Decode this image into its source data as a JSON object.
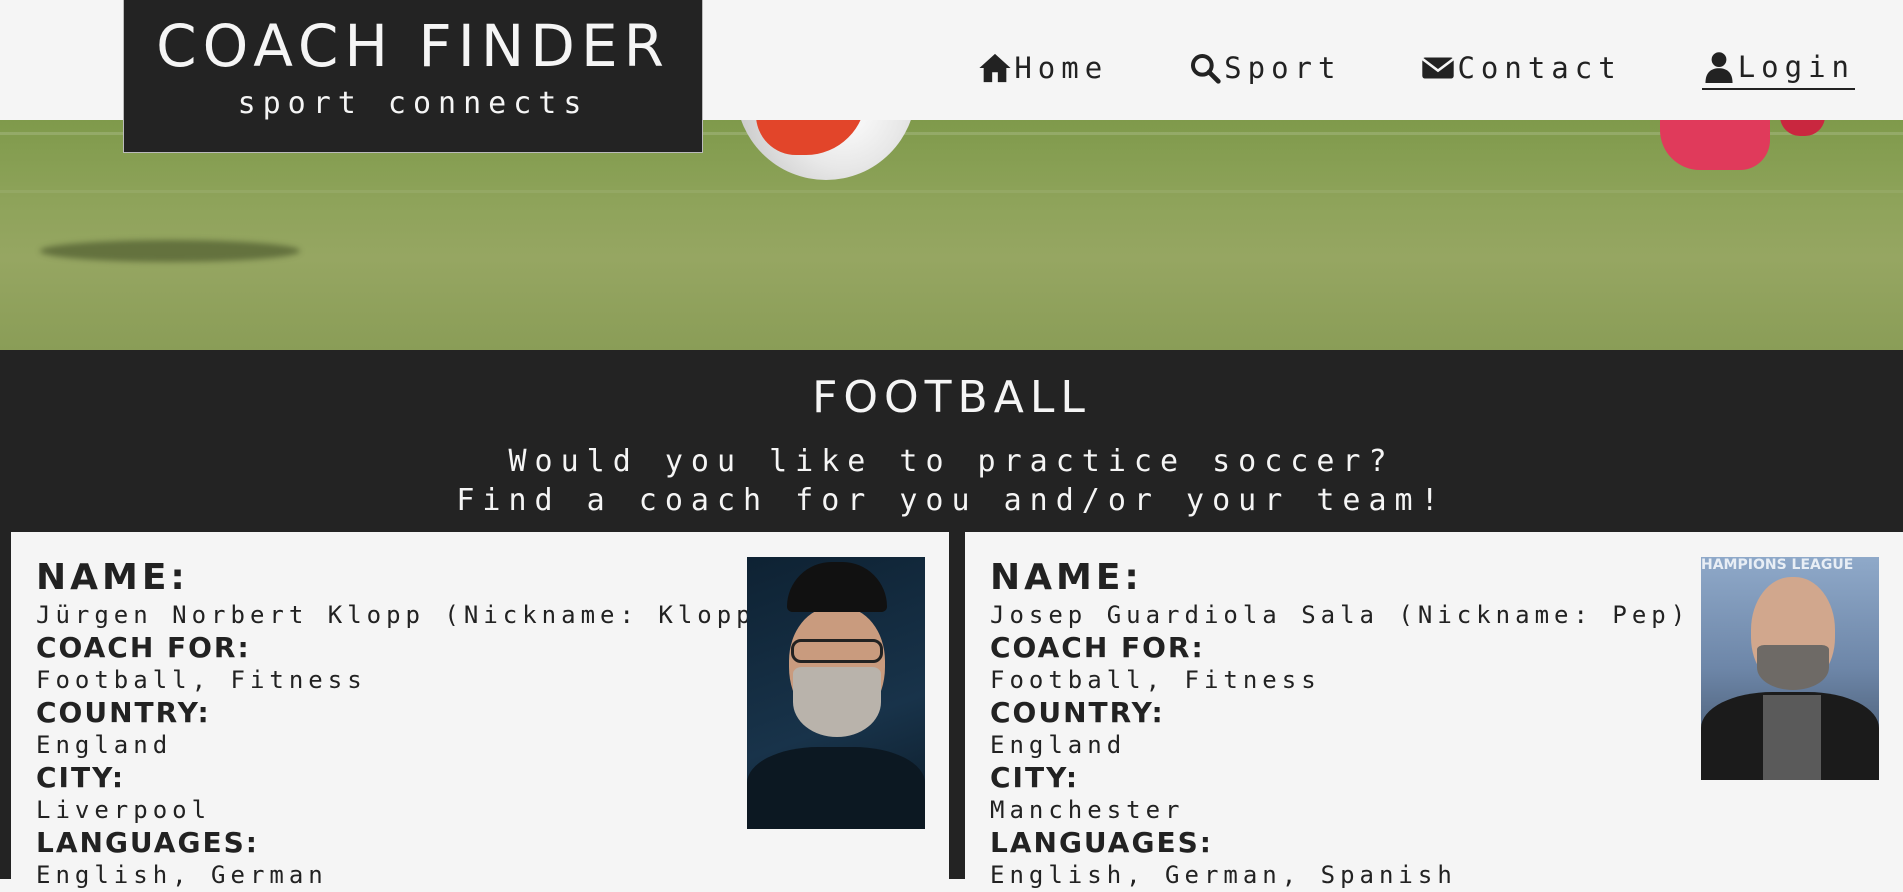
{
  "brand": {
    "title": "COACH FINDER",
    "subtitle": "sport connects"
  },
  "nav": [
    {
      "label": "Home",
      "icon": "home-icon"
    },
    {
      "label": "Sport",
      "icon": "search-icon"
    },
    {
      "label": "Contact",
      "icon": "envelope-icon"
    },
    {
      "label": "Login",
      "icon": "user-icon",
      "active": true
    }
  ],
  "section": {
    "title": "FOOTBALL",
    "subtitle_line1": "Would you like to practice soccer?",
    "subtitle_line2": "Find a coach for you and/or your team!"
  },
  "labels": {
    "name": "NAME:",
    "coach_for": "COACH FOR:",
    "country": "COUNTRY:",
    "city": "CITY:",
    "languages": "LANGUAGES:"
  },
  "coaches": [
    {
      "name": "Jürgen Norbert Klopp (Nickname: Kloppo)",
      "coach_for": "Football, Fitness",
      "country": "England",
      "city": "Liverpool",
      "languages": "English, German"
    },
    {
      "name": "Josep Guardiola Sala (Nickname: Pep)",
      "coach_for": "Football, Fitness",
      "country": "England",
      "city": "Manchester",
      "languages": "English, German, Spanish",
      "photo_text": "HAMPIONS LEAGUE"
    }
  ],
  "colors": {
    "dark": "#232323",
    "light": "#f5f5f5",
    "text": "#222222"
  }
}
